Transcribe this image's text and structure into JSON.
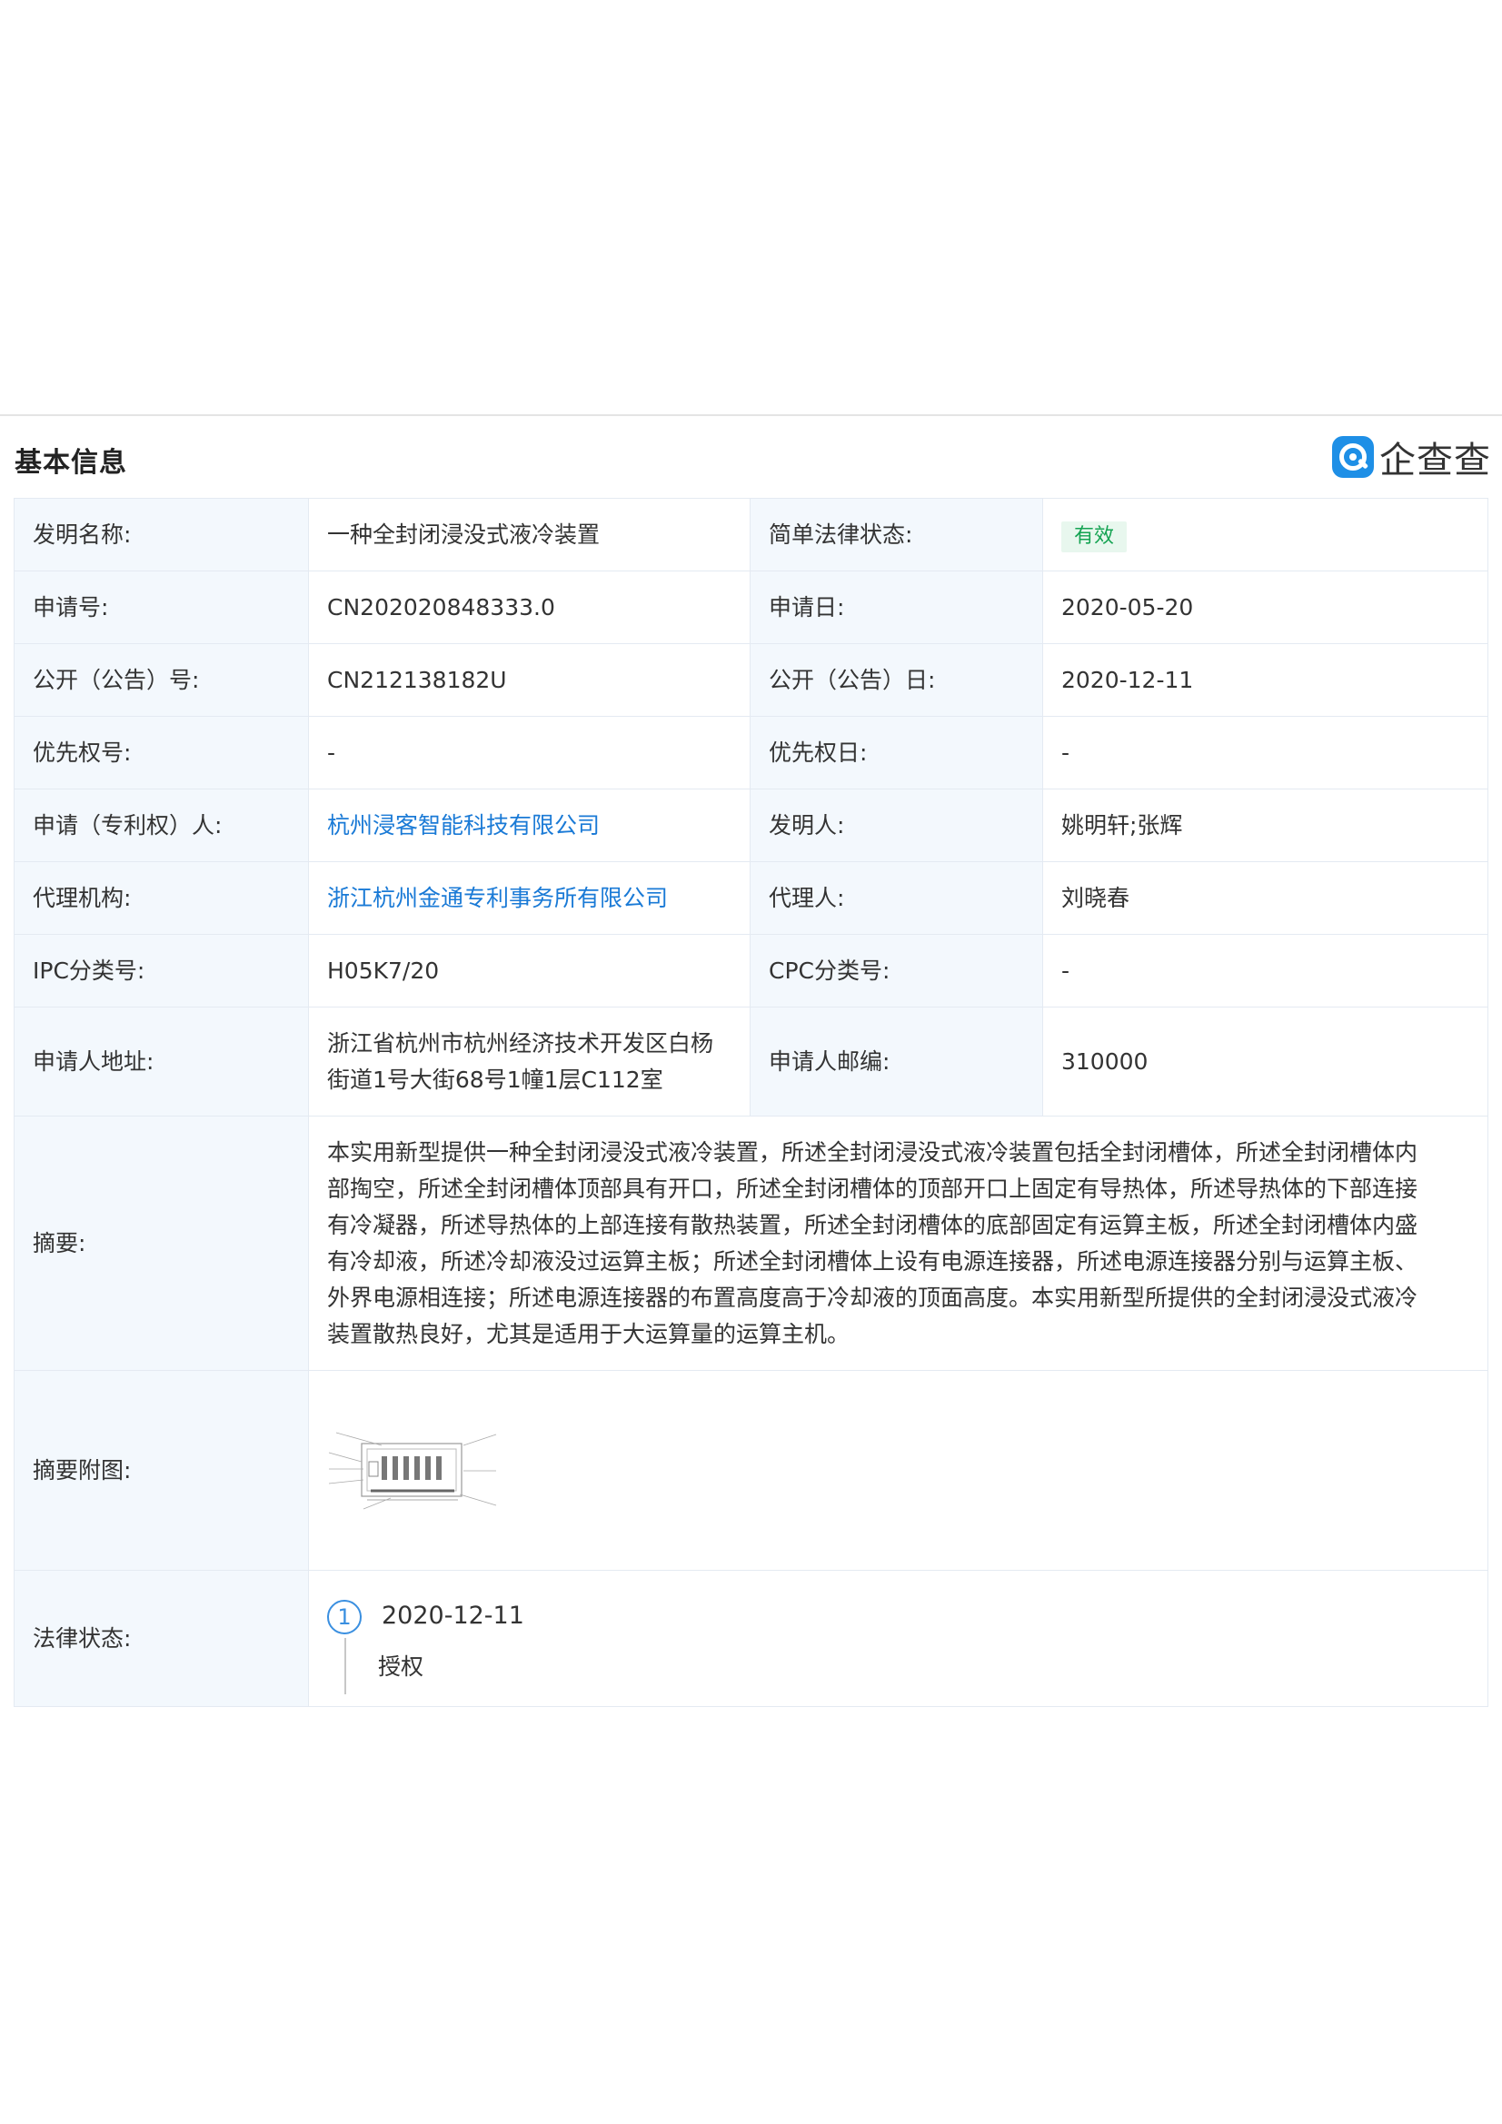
{
  "section": {
    "title": "基本信息"
  },
  "logo": {
    "text": "企查查"
  },
  "rows": {
    "r1": {
      "l1": "发明名称:",
      "v1": "一种全封闭浸没式液冷装置",
      "l2": "简单法律状态:",
      "v2": "有效"
    },
    "r2": {
      "l1": "申请号:",
      "v1": "CN202020848333.0",
      "l2": "申请日:",
      "v2": "2020-05-20"
    },
    "r3": {
      "l1": "公开（公告）号:",
      "v1": "CN212138182U",
      "l2": "公开（公告）日:",
      "v2": "2020-12-11"
    },
    "r4": {
      "l1": "优先权号:",
      "v1": "-",
      "l2": "优先权日:",
      "v2": "-"
    },
    "r5": {
      "l1": "申请（专利权）人:",
      "v1": "杭州浸客智能科技有限公司",
      "l2": "发明人:",
      "v2": "姚明轩;张辉"
    },
    "r6": {
      "l1": "代理机构:",
      "v1": "浙江杭州金通专利事务所有限公司",
      "l2": "代理人:",
      "v2": "刘晓春"
    },
    "r7": {
      "l1": "IPC分类号:",
      "v1": "H05K7/20",
      "l2": "CPC分类号:",
      "v2": "-"
    },
    "r8": {
      "l1": "申请人地址:",
      "v1a": "浙江省杭州市杭州经济技术开发区白杨",
      "v1b": "街道1号大街68号1幢1层C112室",
      "l2": "申请人邮编:",
      "v2": "310000"
    }
  },
  "abstract": {
    "label": "摘要:",
    "lines": [
      "本实用新型提供一种全封闭浸没式液冷装置，所述全封闭浸没式液冷装置包括全封闭槽体，所述全封闭槽体内",
      "部掏空，所述全封闭槽体顶部具有开口，所述全封闭槽体的顶部开口上固定有导热体，所述导热体的下部连接",
      "有冷凝器，所述导热体的上部连接有散热装置，所述全封闭槽体的底部固定有运算主板，所述全封闭槽体内盛",
      "有冷却液，所述冷却液没过运算主板；所述全封闭槽体上设有电源连接器，所述电源连接器分别与运算主板、",
      "外界电源相连接；所述电源连接器的布置高度高于冷却液的顶面高度。本实用新型所提供的全封闭浸没式液冷",
      "装置散热良好，尤其是适用于大运算量的运算主机。"
    ]
  },
  "figure": {
    "label": "摘要附图:"
  },
  "legal": {
    "label": "法律状态:",
    "events": [
      {
        "index": "1",
        "date": "2020-12-11",
        "event": "授权"
      }
    ]
  },
  "colors": {
    "link": "#1a7ad6",
    "label_bg": "#f3f8fd",
    "badge_bg": "#e8f7ee",
    "badge_text": "#14a352",
    "timeline": "#3a8fe0"
  }
}
